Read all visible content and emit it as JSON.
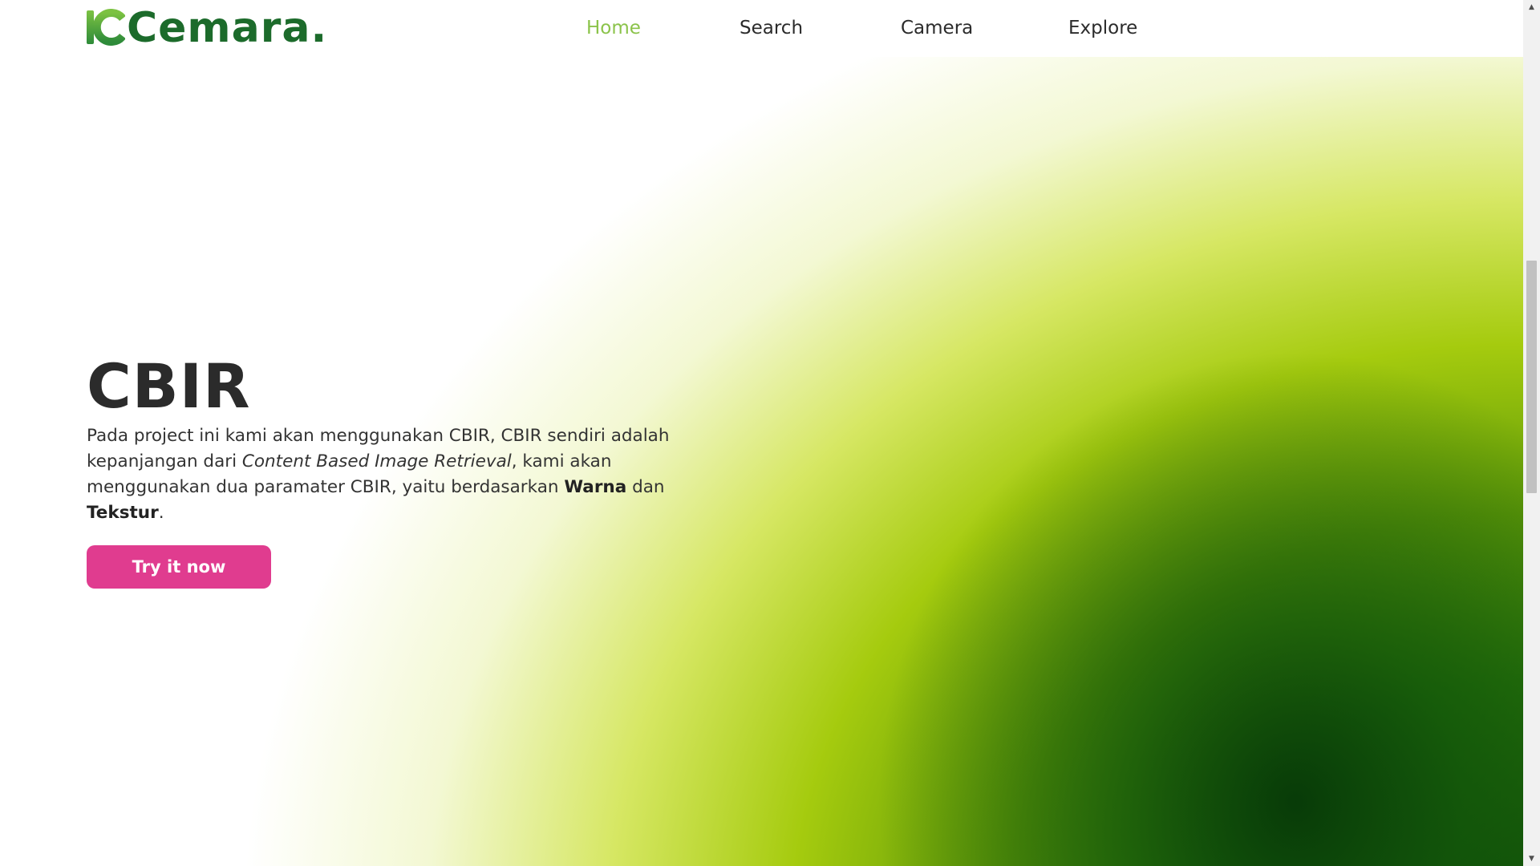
{
  "brand": {
    "name": "Cemara",
    "dot": ".",
    "color": "#1c6b2b",
    "accent": "#8bc34a"
  },
  "nav": {
    "items": [
      {
        "label": "Home",
        "active": true
      },
      {
        "label": "Search",
        "active": false
      },
      {
        "label": "Camera",
        "active": false
      },
      {
        "label": "Explore",
        "active": false
      }
    ]
  },
  "hero": {
    "title": "CBIR",
    "description": {
      "part1": "Pada project ini kami akan menggunakan CBIR, CBIR sendiri adalah kepanjangan dari ",
      "italic": "Content Based Image Retrieval",
      "part2": ", kami akan menggunakan dua paramater CBIR, yaitu berdasarkan ",
      "bold1": "Warna",
      "part3": " dan ",
      "bold2": "Tekstur",
      "part4": "."
    },
    "cta_label": "Try it now",
    "cta_color": "#e03c8f"
  },
  "scrollbar": {
    "up_icon": "arrow-up-icon",
    "down_icon": "arrow-down-icon"
  }
}
